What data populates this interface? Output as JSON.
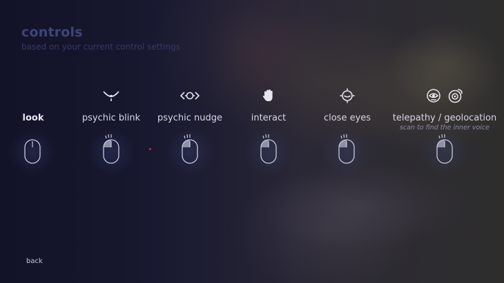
{
  "header": {
    "title": "controls",
    "subtitle": "based on your current control settings"
  },
  "controls": [
    {
      "label": "look",
      "icon": "",
      "button": "none"
    },
    {
      "label": "psychic blink",
      "icon": "blink-icon",
      "button": "left"
    },
    {
      "label": "psychic nudge",
      "icon": "nudge-icon",
      "button": "left"
    },
    {
      "label": "interact",
      "icon": "hand-icon",
      "button": "left"
    },
    {
      "label": "close eyes",
      "icon": "closed-eye-icon",
      "button": "left"
    },
    {
      "label": "telepathy / geolocation",
      "hint": "scan to find the inner voice",
      "icon": "telepathy-icon",
      "button": "left"
    }
  ],
  "footer": {
    "back_label": "back"
  },
  "colors": {
    "title": "#404577",
    "label": "#d7d7e4",
    "icon": "#e6e6ee"
  }
}
